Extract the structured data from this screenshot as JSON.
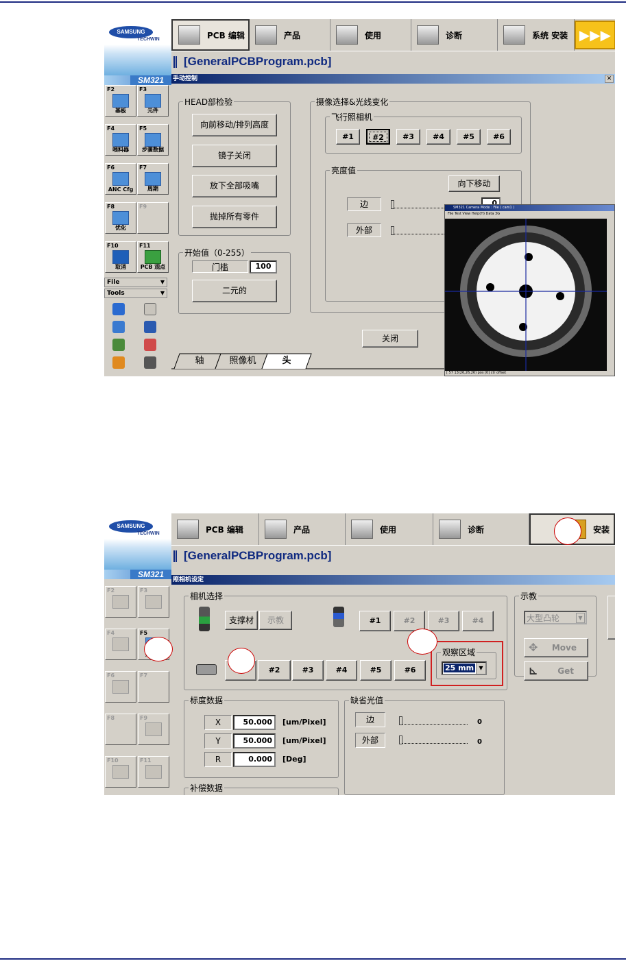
{
  "screen1": {
    "brand": {
      "logo": "SAMSUNG",
      "sub": "TECHWIN",
      "model": "SM321"
    },
    "toolbar": [
      {
        "label": "PCB 编辑",
        "icon": "pcb-edit-icon",
        "selected": true
      },
      {
        "label": "产品",
        "icon": "product-icon"
      },
      {
        "label": "使用",
        "icon": "use-icon"
      },
      {
        "label": "诊断",
        "icon": "diagnose-icon"
      },
      {
        "label": "系统 安装",
        "icon": "system-setup-icon"
      }
    ],
    "arrow_label": "▶▶▶",
    "file": "[GeneralPCBProgram.pcb]",
    "dialog_title": "手动控制",
    "fkeys": [
      {
        "key": "F2",
        "label": "基板"
      },
      {
        "key": "F3",
        "label": "元件"
      },
      {
        "key": "F4",
        "label": "喂料器"
      },
      {
        "key": "F5",
        "label": "步骤数据"
      },
      {
        "key": "F6",
        "label": "ANC Cfg"
      },
      {
        "key": "F7",
        "label": "周期"
      },
      {
        "key": "F8",
        "label": "优化"
      },
      {
        "key": "F9",
        "label": ""
      },
      {
        "key": "F10",
        "label": "取消"
      },
      {
        "key": "F11",
        "label": "PCB 观点"
      }
    ],
    "menus": [
      "File",
      "Tools"
    ],
    "head_group": {
      "title": "HEAD部检验",
      "buttons": [
        "向前移动/排列高度",
        "镜子关闭",
        "放下全部吸嘴",
        "抛掉所有零件"
      ]
    },
    "start_group": {
      "title": "开始值（0-255）",
      "threshold_label": "门槛",
      "threshold_value": "100",
      "binary_button": "二元的"
    },
    "camera_group": {
      "title": "摄像选择&光线变化",
      "flying_title": "飞行照相机",
      "cams": [
        "#1",
        "#2",
        "#3",
        "#4",
        "#5",
        "#6"
      ],
      "selected": 1
    },
    "brightness": {
      "title": "亮度值",
      "move_button": "向下移动",
      "edge": "边",
      "edge_value": "0",
      "outer": "外部"
    },
    "close_button": "关闭",
    "tabs": [
      "轴",
      "照像机",
      "头"
    ],
    "camera_view": {
      "title": "SM321 Camera Mode : File ( cam1 )",
      "menu": "File  Test  View  Help(H)  Data  3G",
      "status": "[ 57   13(26,26,26)           pos [0] ctr    offset"
    }
  },
  "screen2": {
    "toolbar": [
      {
        "label": "PCB 编辑",
        "icon": "pcb-edit-icon"
      },
      {
        "label": "产品",
        "icon": "product-icon"
      },
      {
        "label": "使用",
        "icon": "use-icon"
      },
      {
        "label": "诊断",
        "icon": "diagnose-icon"
      },
      {
        "label": "安装",
        "icon": "install-icon",
        "selected": true
      }
    ],
    "file": "[GeneralPCBProgram.pcb]",
    "dialog_title": "照相机设定",
    "fkeys": [
      {
        "key": "F2",
        "label": "",
        "disabled": true
      },
      {
        "key": "F3",
        "label": "",
        "disabled": true
      },
      {
        "key": "F4",
        "label": "",
        "disabled": true
      },
      {
        "key": "F5",
        "label": "照相机",
        "disabled": false
      },
      {
        "key": "F6",
        "label": "",
        "disabled": true
      },
      {
        "key": "F7",
        "label": "",
        "disabled": true
      },
      {
        "key": "F8",
        "label": "",
        "disabled": true
      },
      {
        "key": "F9",
        "label": "",
        "disabled": true
      },
      {
        "key": "F10",
        "label": "",
        "disabled": true
      },
      {
        "key": "F11",
        "label": "",
        "disabled": true
      }
    ],
    "camera_select": {
      "title": "相机选择",
      "support": "支撑材",
      "teach": "示教",
      "upper_cams": [
        "#1",
        "#2",
        "#3",
        "#4"
      ],
      "lower_cams": [
        "#1",
        "#2",
        "#3",
        "#4",
        "#5",
        "#6"
      ],
      "view_area_title": "观察区域",
      "view_area_value": "25 mm"
    },
    "teach_group": {
      "title": "示教",
      "select_value": "大型凸轮",
      "move": "Move",
      "get": "Get"
    },
    "scale": {
      "title": "标度数据",
      "rows": [
        {
          "axis": "X",
          "value": "50.000",
          "unit": "[um/Pixel]"
        },
        {
          "axis": "Y",
          "value": "50.000",
          "unit": "[um/Pixel]"
        },
        {
          "axis": "R",
          "value": "0.000",
          "unit": "[Deg]"
        }
      ]
    },
    "default_light": {
      "title": "缺省光值",
      "edge": "边",
      "edge_value": "0",
      "outer": "外部",
      "outer_value": "0"
    },
    "compensation": {
      "title": "补偿数据"
    }
  }
}
